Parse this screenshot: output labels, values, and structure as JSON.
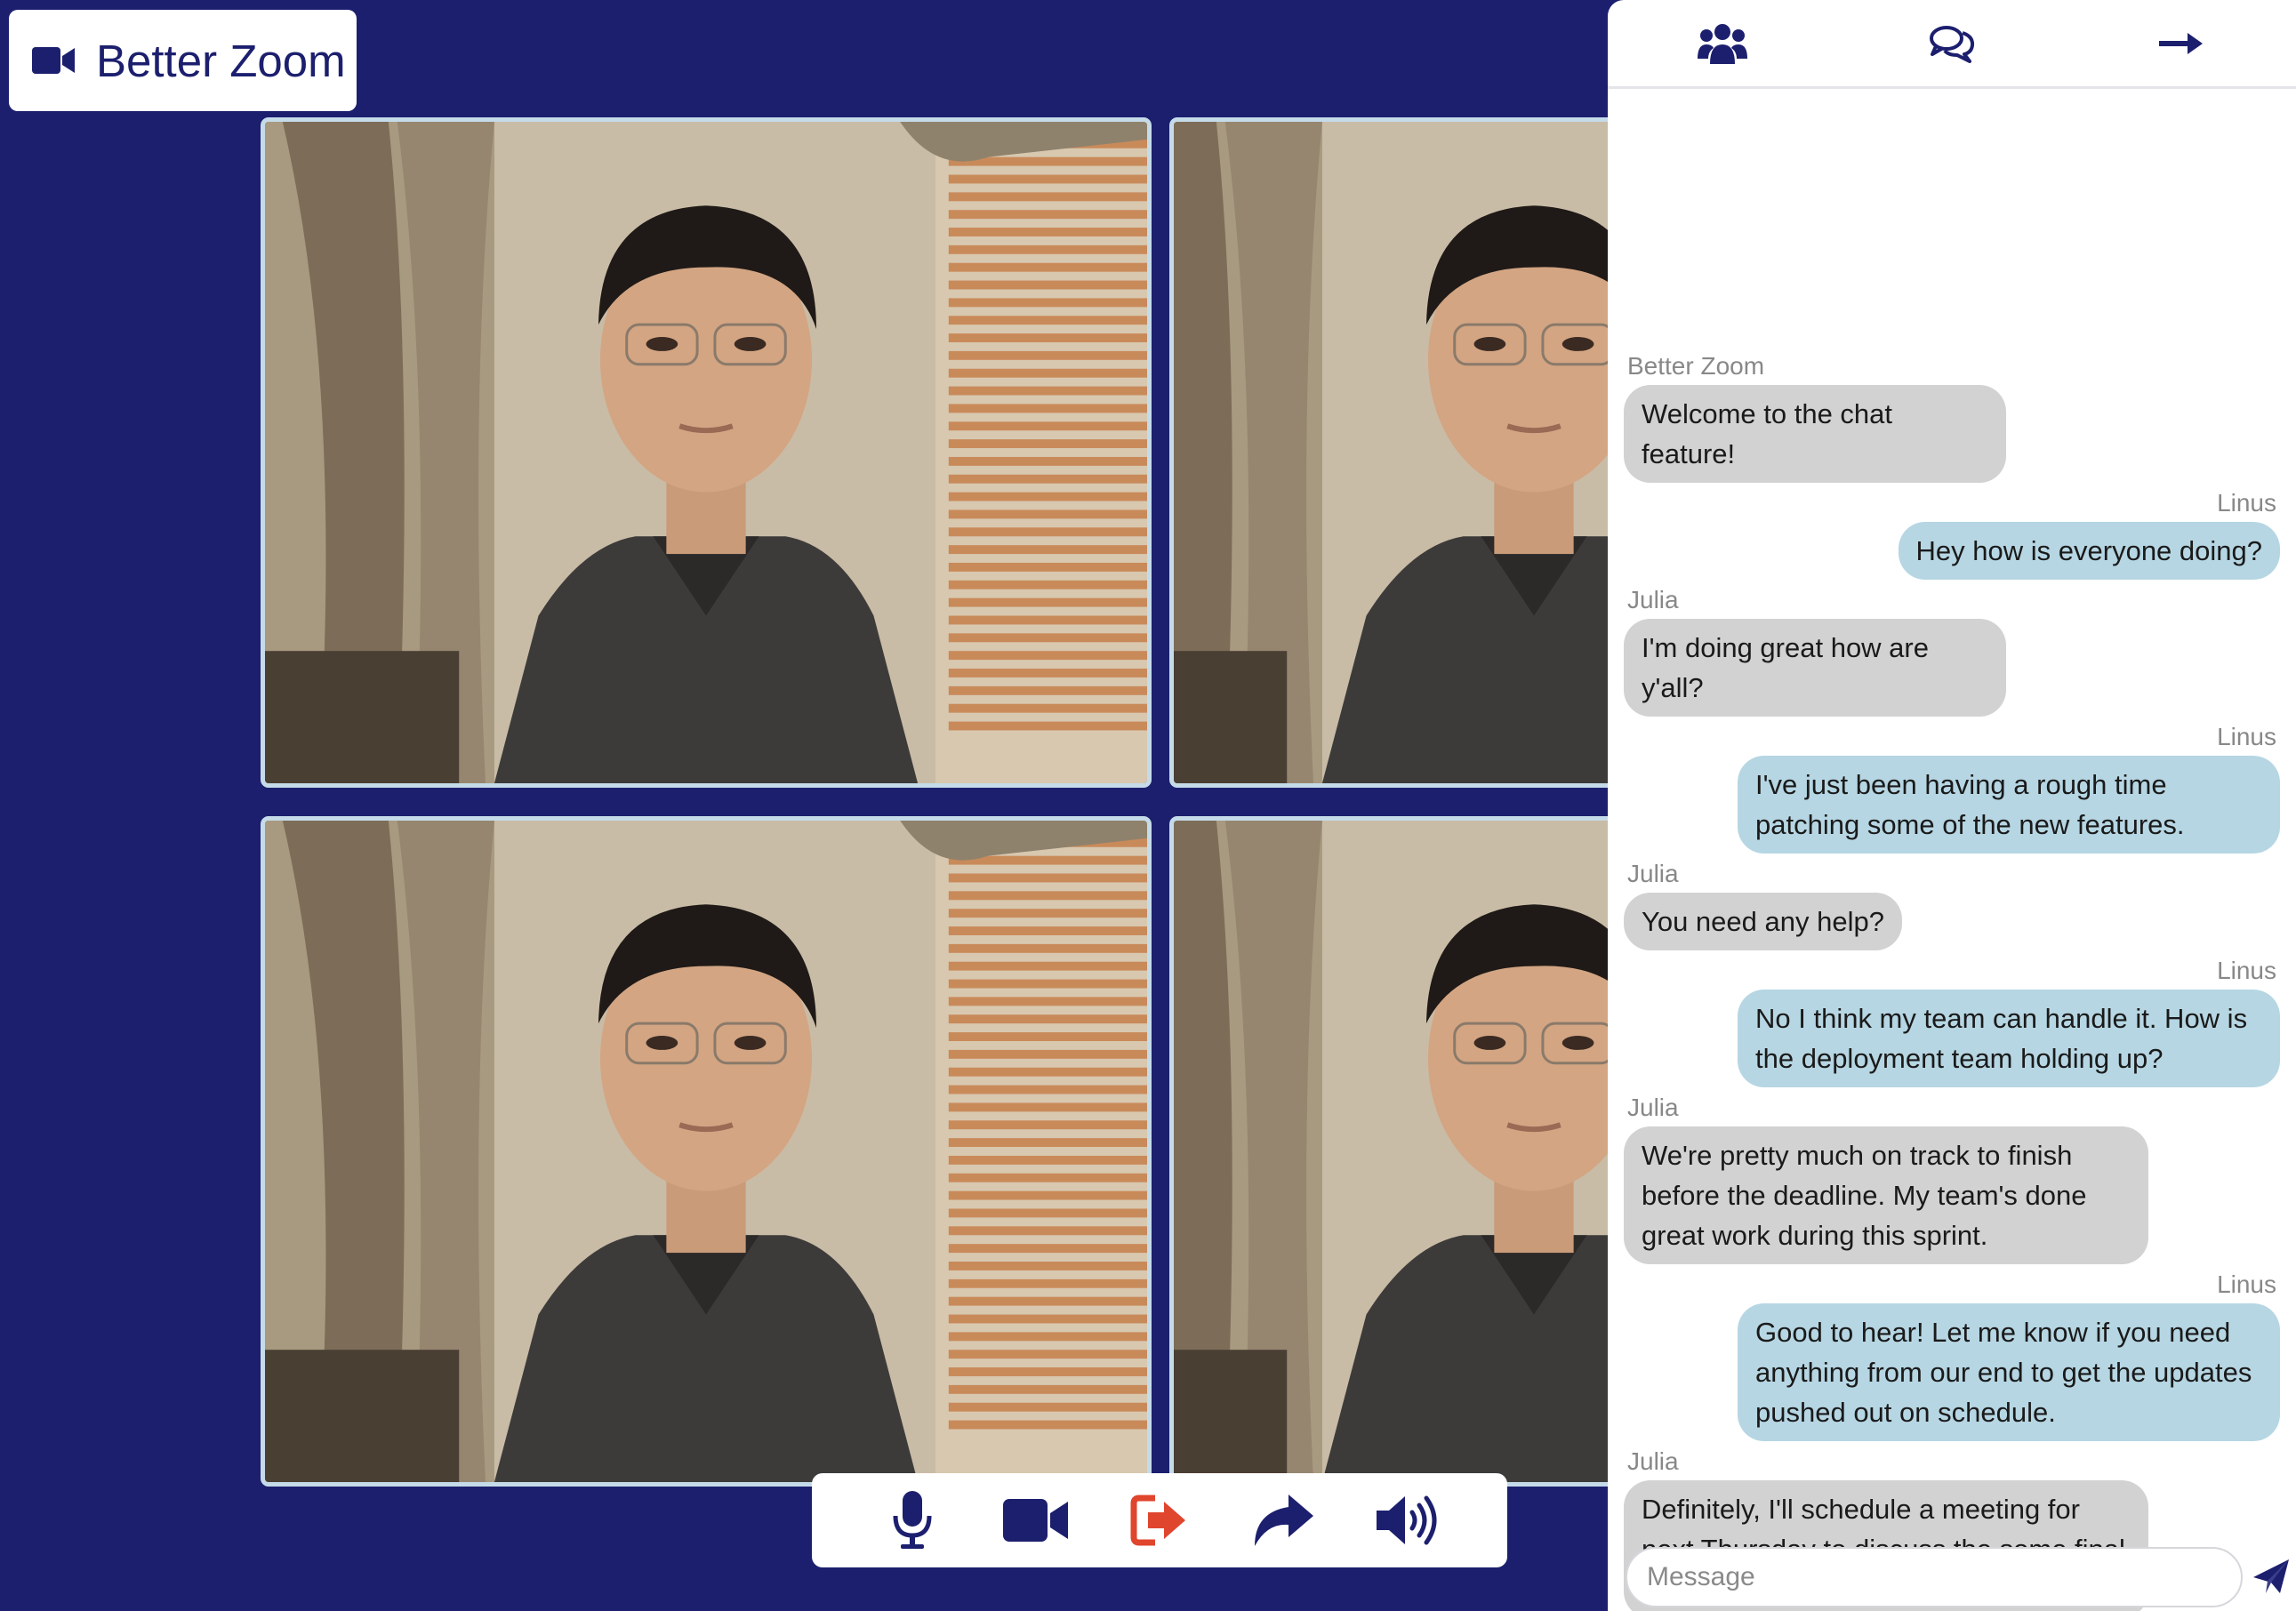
{
  "app": {
    "title": "Better Zoom",
    "logo_icon": "video-camera-icon",
    "brand_color": "#1c1f6e"
  },
  "video_grid": {
    "tiles": [
      {
        "name": "participant-video-1"
      },
      {
        "name": "participant-video-2"
      },
      {
        "name": "participant-video-3"
      },
      {
        "name": "participant-video-4"
      }
    ]
  },
  "controls": [
    {
      "icon": "microphone-icon",
      "color": "#1c1f6e"
    },
    {
      "icon": "video-camera-icon",
      "color": "#1c1f6e"
    },
    {
      "icon": "leave-icon",
      "color": "#e0452e"
    },
    {
      "icon": "share-icon",
      "color": "#1c1f6e"
    },
    {
      "icon": "volume-icon",
      "color": "#1c1f6e"
    }
  ],
  "panel": {
    "tabs": [
      {
        "icon": "participants-icon"
      },
      {
        "icon": "chat-icon"
      },
      {
        "icon": "arrow-right-icon"
      }
    ],
    "messages": [
      {
        "sender": "Better Zoom",
        "side": "left",
        "text": "Welcome to the chat feature!"
      },
      {
        "sender": "Linus",
        "side": "right",
        "text": "Hey how is everyone doing?"
      },
      {
        "sender": "Julia",
        "side": "left",
        "text": "I'm doing great how are y'all?"
      },
      {
        "sender": "Linus",
        "side": "right",
        "text": "I've just been having a rough time patching some of the new features."
      },
      {
        "sender": "Julia",
        "side": "left",
        "text": "You need any help?"
      },
      {
        "sender": "Linus",
        "side": "right",
        "text": "No I think my team can handle it. How is the deployment team holding up?"
      },
      {
        "sender": "Julia",
        "side": "left",
        "text": "We're pretty much on track to finish before the deadline. My team's done great work during this sprint."
      },
      {
        "sender": "Linus",
        "side": "right",
        "text": "Good to hear! Let me know if you need anything from our end to get the updates pushed out on schedule."
      },
      {
        "sender": "Julia",
        "side": "left",
        "text": "Definitely, I'll schedule a meeting for next Thursday to discuss the some final concerns before the rollout."
      }
    ],
    "composer": {
      "placeholder": "Message",
      "value": "",
      "send_icon": "send-icon"
    }
  }
}
